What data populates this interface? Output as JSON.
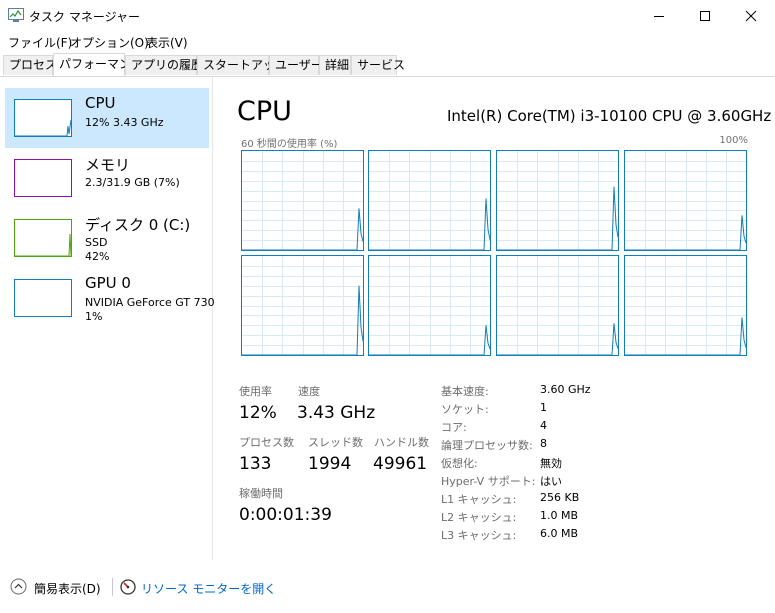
{
  "window": {
    "title": "タスク マネージャー",
    "minimize_glyph": "—",
    "maximize_glyph": "☐",
    "close_glyph": "✕"
  },
  "menu": [
    "ファイル(F)",
    "オプション(O)",
    "表示(V)"
  ],
  "tabs": [
    {
      "label": "プロセス",
      "active": false
    },
    {
      "label": "パフォーマンス",
      "active": true
    },
    {
      "label": "アプリの履歴",
      "active": false
    },
    {
      "label": "スタートアップ",
      "active": false
    },
    {
      "label": "ユーザー",
      "active": false
    },
    {
      "label": "詳細",
      "active": false
    },
    {
      "label": "サービス",
      "active": false
    }
  ],
  "resources": [
    {
      "title": "CPU",
      "lines": [
        "12%  3.43 GHz"
      ],
      "color": "#117dbb",
      "selected": true
    },
    {
      "title": "メモリ",
      "lines": [
        "2.3/31.9 GB (7%)"
      ],
      "color": "#8b12ae",
      "selected": false
    },
    {
      "title": "ディスク 0 (C:)",
      "lines": [
        "SSD",
        "42%"
      ],
      "color": "#4da60c",
      "selected": false
    },
    {
      "title": "GPU 0",
      "lines": [
        "NVIDIA GeForce GT 730",
        "1%"
      ],
      "color": "#117dbb",
      "selected": false
    }
  ],
  "main": {
    "heading": "CPU",
    "model": "Intel(R) Core(TM) i3-10100 CPU @ 3.60GHz",
    "graph_caption_left": "60 秒間の使用率 (%)",
    "graph_caption_right": "100%",
    "graph_color": "#117dbb",
    "core_spike_levels": [
      0.42,
      0.52,
      0.64,
      0.35,
      0.7,
      0.3,
      0.32,
      0.38
    ],
    "stats": {
      "usage_label": "使用率",
      "usage_value": "12%",
      "speed_label": "速度",
      "speed_value": "3.43 GHz",
      "processes_label": "プロセス数",
      "processes_value": "133",
      "threads_label": "スレッド数",
      "threads_value": "1994",
      "handles_label": "ハンドル数",
      "handles_value": "49961",
      "uptime_label": "稼働時間",
      "uptime_value": "0:00:01:39"
    },
    "specs": [
      {
        "label": "基本速度:",
        "value": "3.60 GHz"
      },
      {
        "label": "ソケット:",
        "value": "1"
      },
      {
        "label": "コア:",
        "value": "4"
      },
      {
        "label": "論理プロセッサ数:",
        "value": "8"
      },
      {
        "label": "仮想化:",
        "value": "無効"
      },
      {
        "label": "Hyper-V サポート:",
        "value": "はい"
      },
      {
        "label": "L1 キャッシュ:",
        "value": "256 KB"
      },
      {
        "label": "L2 キャッシュ:",
        "value": "1.0 MB"
      },
      {
        "label": "L3 キャッシュ:",
        "value": "6.0 MB"
      }
    ]
  },
  "footer": {
    "fewer_details": "簡易表示(D)",
    "resource_monitor": "リソース モニターを開く"
  }
}
